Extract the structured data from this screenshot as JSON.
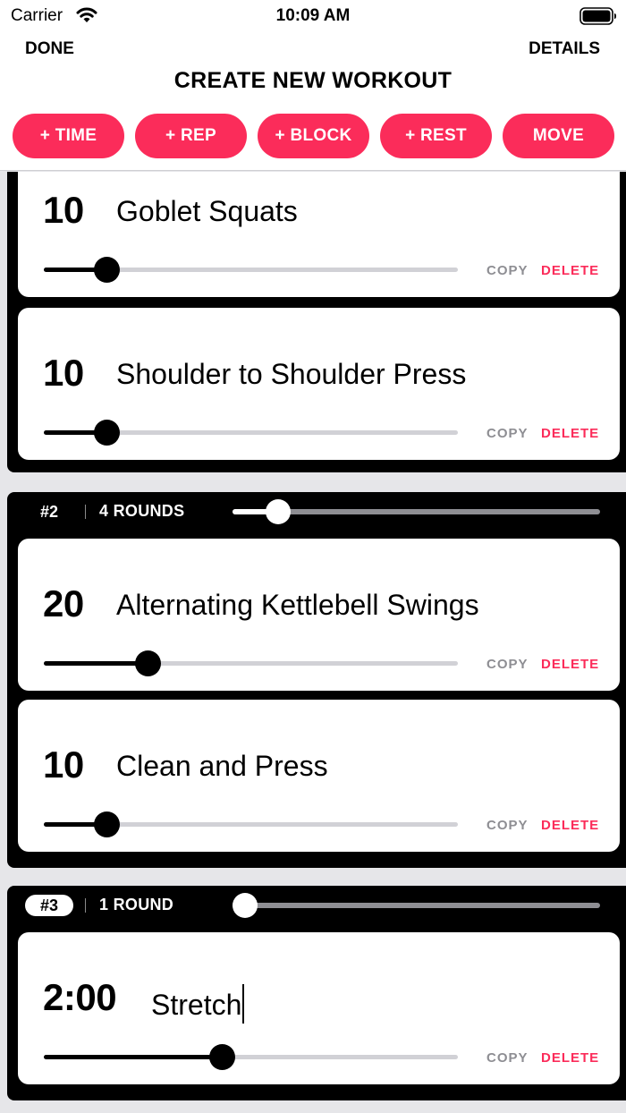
{
  "status_bar": {
    "carrier": "Carrier",
    "time": "10:09 AM"
  },
  "header": {
    "done_label": "DONE",
    "details_label": "DETAILS",
    "title": "CREATE NEW WORKOUT"
  },
  "toolbar": {
    "buttons": [
      {
        "label": "+ TIME"
      },
      {
        "label": "+ REP"
      },
      {
        "label": "+ BLOCK"
      },
      {
        "label": "+ REST"
      },
      {
        "label": "MOVE"
      }
    ]
  },
  "colors": {
    "accent": "#fb2c5a",
    "block_background": "#000000",
    "card_background": "#ffffff",
    "page_background": "#e6e6e9",
    "muted_text": "#8e8e93"
  },
  "actions": {
    "copy_label": "COPY",
    "delete_label": "DELETE"
  },
  "blocks": [
    {
      "exercises": [
        {
          "count": "10",
          "name": "Goblet Squats",
          "slider_level": 0.12
        },
        {
          "count": "10",
          "name": "Shoulder to Shoulder Press",
          "slider_level": 0.12
        }
      ]
    },
    {
      "number": "#2",
      "rounds": "4 ROUNDS",
      "rounds_slider_level": 0.09,
      "exercises": [
        {
          "count": "20",
          "name": "Alternating Kettlebell Swings",
          "slider_level": 0.22
        },
        {
          "count": "10",
          "name": "Clean and Press",
          "slider_level": 0.12
        }
      ]
    },
    {
      "number": "#3",
      "rounds": "1 ROUND",
      "rounds_slider_level": 0.0,
      "selected": true,
      "exercises": [
        {
          "count": "2:00",
          "name": "Stretch",
          "slider_level": 0.4,
          "editing": true
        }
      ]
    }
  ]
}
